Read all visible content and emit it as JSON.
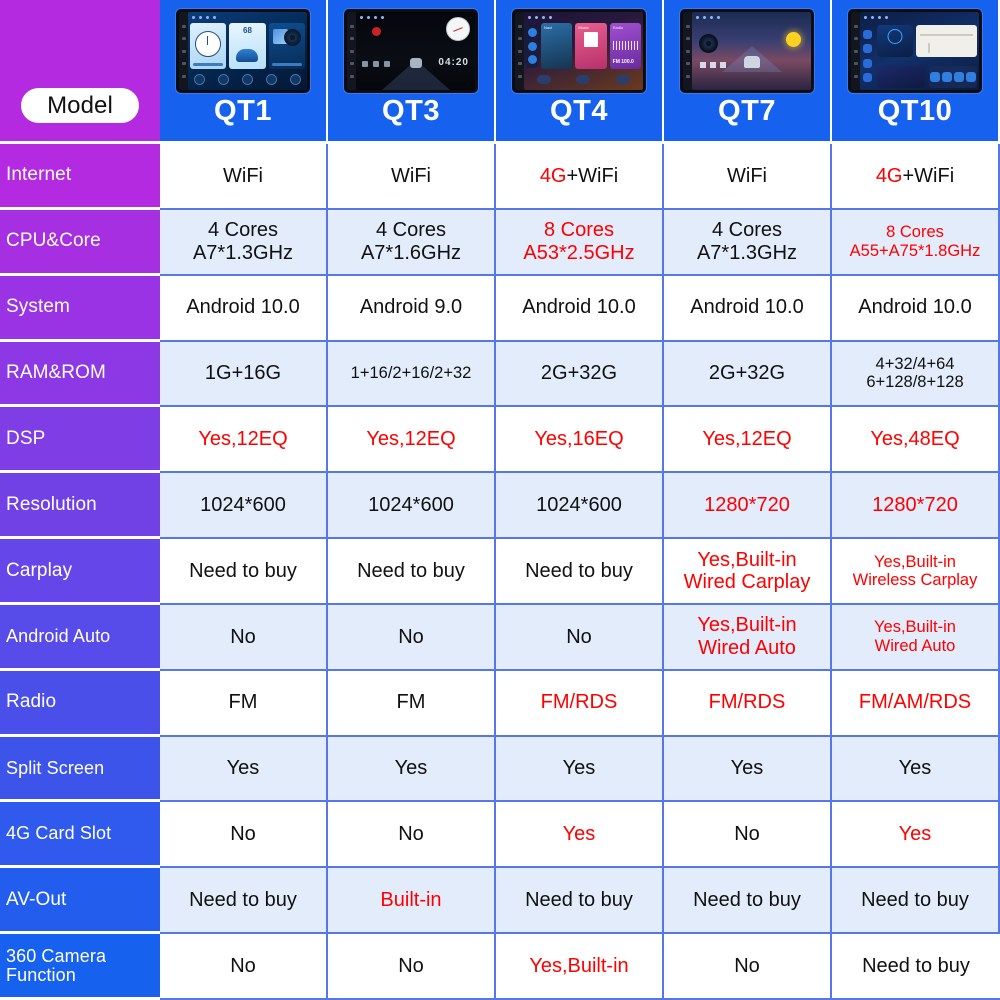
{
  "header": {
    "model_label": "Model",
    "models": [
      {
        "name": "QT1",
        "device": "qt1",
        "device_desc": "blue-themed-android-head-unit-home-screen"
      },
      {
        "name": "QT3",
        "device": "qt3",
        "device_desc": "dark-themed-head-unit-with-road-graphic"
      },
      {
        "name": "QT4",
        "device": "qt4",
        "device_desc": "card-tile-ui-head-unit-screen"
      },
      {
        "name": "QT7",
        "device": "qt7",
        "device_desc": "sunset-road-head-unit-screen"
      },
      {
        "name": "QT10",
        "device": "qt10",
        "device_desc": "split-layout-head-unit-with-map"
      }
    ]
  },
  "colors": {
    "label_gradient_start": "#b32ae0",
    "label_gradient_end": "#1662ef",
    "model_header_bg": "#1662ef",
    "grid_line": "#5577e8",
    "row_alt_bg": "#e2ecfb",
    "highlight_text": "#ff0000",
    "normal_text": "#111111"
  },
  "rows": [
    {
      "label": "Internet",
      "shade": "plain",
      "cells": [
        {
          "parts": [
            {
              "t": "WiFi",
              "red": false
            }
          ]
        },
        {
          "parts": [
            {
              "t": "WiFi",
              "red": false
            }
          ]
        },
        {
          "parts": [
            {
              "t": "4G",
              "red": true
            },
            {
              "t": "+WiFi",
              "red": false
            }
          ]
        },
        {
          "parts": [
            {
              "t": "WiFi",
              "red": false
            }
          ]
        },
        {
          "parts": [
            {
              "t": "4G",
              "red": true
            },
            {
              "t": "+WiFi",
              "red": false
            }
          ]
        }
      ]
    },
    {
      "label": "CPU&Core",
      "shade": "alt",
      "cells": [
        {
          "lines": [
            "4 Cores",
            "A7*1.3GHz"
          ],
          "red": false
        },
        {
          "lines": [
            "4 Cores",
            "A7*1.6GHz"
          ],
          "red": false
        },
        {
          "lines": [
            "8 Cores",
            "A53*2.5GHz"
          ],
          "red": true
        },
        {
          "lines": [
            "4 Cores",
            "A7*1.3GHz"
          ],
          "red": false
        },
        {
          "lines": [
            "8 Cores",
            "A55+A75*1.8GHz"
          ],
          "red": true,
          "small": true
        }
      ]
    },
    {
      "label": "System",
      "shade": "plain",
      "cells": [
        {
          "lines": [
            "Android 10.0"
          ],
          "red": false
        },
        {
          "lines": [
            "Android 9.0"
          ],
          "red": false
        },
        {
          "lines": [
            "Android 10.0"
          ],
          "red": false
        },
        {
          "lines": [
            "Android 10.0"
          ],
          "red": false
        },
        {
          "lines": [
            "Android 10.0"
          ],
          "red": false
        }
      ]
    },
    {
      "label": "RAM&ROM",
      "shade": "alt",
      "cells": [
        {
          "lines": [
            "1G+16G"
          ],
          "red": false
        },
        {
          "lines": [
            "1+16/2+16/2+32"
          ],
          "red": false,
          "small": true
        },
        {
          "lines": [
            "2G+32G"
          ],
          "red": false
        },
        {
          "lines": [
            "2G+32G"
          ],
          "red": false
        },
        {
          "lines": [
            "4+32/4+64",
            "6+128/8+128"
          ],
          "red": false,
          "small": true
        }
      ]
    },
    {
      "label": "DSP",
      "shade": "plain",
      "cells": [
        {
          "lines": [
            "Yes,12EQ"
          ],
          "red": true
        },
        {
          "lines": [
            "Yes,12EQ"
          ],
          "red": true
        },
        {
          "lines": [
            "Yes,16EQ"
          ],
          "red": true
        },
        {
          "lines": [
            "Yes,12EQ"
          ],
          "red": true
        },
        {
          "lines": [
            "Yes,48EQ"
          ],
          "red": true
        }
      ]
    },
    {
      "label": "Resolution",
      "shade": "alt",
      "cells": [
        {
          "lines": [
            "1024*600"
          ],
          "red": false
        },
        {
          "lines": [
            "1024*600"
          ],
          "red": false
        },
        {
          "lines": [
            "1024*600"
          ],
          "red": false
        },
        {
          "lines": [
            "1280*720"
          ],
          "red": true
        },
        {
          "lines": [
            "1280*720"
          ],
          "red": true
        }
      ]
    },
    {
      "label": "Carplay",
      "shade": "plain",
      "cells": [
        {
          "lines": [
            "Need to buy"
          ],
          "red": false
        },
        {
          "lines": [
            "Need to buy"
          ],
          "red": false
        },
        {
          "lines": [
            "Need to buy"
          ],
          "red": false
        },
        {
          "lines": [
            "Yes,Built-in",
            "Wired Carplay"
          ],
          "red": true
        },
        {
          "lines": [
            "Yes,Built-in",
            "Wireless Carplay"
          ],
          "red": true,
          "small": true
        }
      ]
    },
    {
      "label": "Android Auto",
      "shade": "alt",
      "cells": [
        {
          "lines": [
            "No"
          ],
          "red": false
        },
        {
          "lines": [
            "No"
          ],
          "red": false
        },
        {
          "lines": [
            "No"
          ],
          "red": false
        },
        {
          "lines": [
            "Yes,Built-in",
            "Wired Auto"
          ],
          "red": true
        },
        {
          "lines": [
            "Yes,Built-in",
            "Wired Auto"
          ],
          "red": true,
          "small": true
        }
      ]
    },
    {
      "label": "Radio",
      "shade": "plain",
      "cells": [
        {
          "lines": [
            "FM"
          ],
          "red": false
        },
        {
          "lines": [
            "FM"
          ],
          "red": false
        },
        {
          "lines": [
            "FM/RDS"
          ],
          "red": true
        },
        {
          "lines": [
            "FM/RDS"
          ],
          "red": true
        },
        {
          "lines": [
            "FM/AM/RDS"
          ],
          "red": true
        }
      ]
    },
    {
      "label": "Split Screen",
      "shade": "alt",
      "cells": [
        {
          "lines": [
            "Yes"
          ],
          "red": false
        },
        {
          "lines": [
            "Yes"
          ],
          "red": false
        },
        {
          "lines": [
            "Yes"
          ],
          "red": false
        },
        {
          "lines": [
            "Yes"
          ],
          "red": false
        },
        {
          "lines": [
            "Yes"
          ],
          "red": false
        }
      ]
    },
    {
      "label": "4G Card Slot",
      "shade": "plain",
      "cells": [
        {
          "lines": [
            "No"
          ],
          "red": false
        },
        {
          "lines": [
            "No"
          ],
          "red": false
        },
        {
          "lines": [
            "Yes"
          ],
          "red": true
        },
        {
          "lines": [
            "No"
          ],
          "red": false
        },
        {
          "lines": [
            "Yes"
          ],
          "red": true
        }
      ]
    },
    {
      "label": "AV-Out",
      "shade": "alt",
      "cells": [
        {
          "lines": [
            "Need to buy"
          ],
          "red": false
        },
        {
          "lines": [
            "Built-in"
          ],
          "red": true
        },
        {
          "lines": [
            "Need to buy"
          ],
          "red": false
        },
        {
          "lines": [
            "Need to buy"
          ],
          "red": false
        },
        {
          "lines": [
            "Need to buy"
          ],
          "red": false
        }
      ]
    },
    {
      "label": "360 Camera Function",
      "shade": "plain",
      "cells": [
        {
          "lines": [
            "No"
          ],
          "red": false
        },
        {
          "lines": [
            "No"
          ],
          "red": false
        },
        {
          "lines": [
            "Yes,Built-in"
          ],
          "red": true
        },
        {
          "lines": [
            "No"
          ],
          "red": false
        },
        {
          "lines": [
            "Need to buy"
          ],
          "red": false
        }
      ]
    }
  ]
}
